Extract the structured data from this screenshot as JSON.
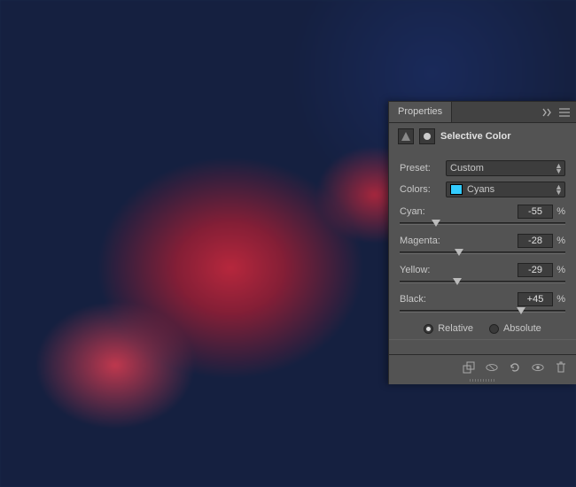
{
  "panel": {
    "tab_label": "Properties",
    "menu_icon": "menu-icon",
    "expand_icon": "expand-icon",
    "adj_title": "Selective Color"
  },
  "preset": {
    "label": "Preset:",
    "value": "Custom"
  },
  "colors": {
    "label": "Colors:",
    "value": "Cyans",
    "swatch": "#33ccff"
  },
  "sliders": {
    "cyan": {
      "label": "Cyan:",
      "value": "-55",
      "unit": "%",
      "pct": 22
    },
    "magenta": {
      "label": "Magenta:",
      "value": "-28",
      "unit": "%",
      "pct": 36
    },
    "yellow": {
      "label": "Yellow:",
      "value": "-29",
      "unit": "%",
      "pct": 35
    },
    "black": {
      "label": "Black:",
      "value": "+45",
      "unit": "%",
      "pct": 73
    }
  },
  "mode": {
    "relative": "Relative",
    "absolute": "Absolute",
    "selected": "relative"
  },
  "footer_icons": [
    "clip-to-layer",
    "view-previous",
    "reset",
    "visibility",
    "delete"
  ]
}
